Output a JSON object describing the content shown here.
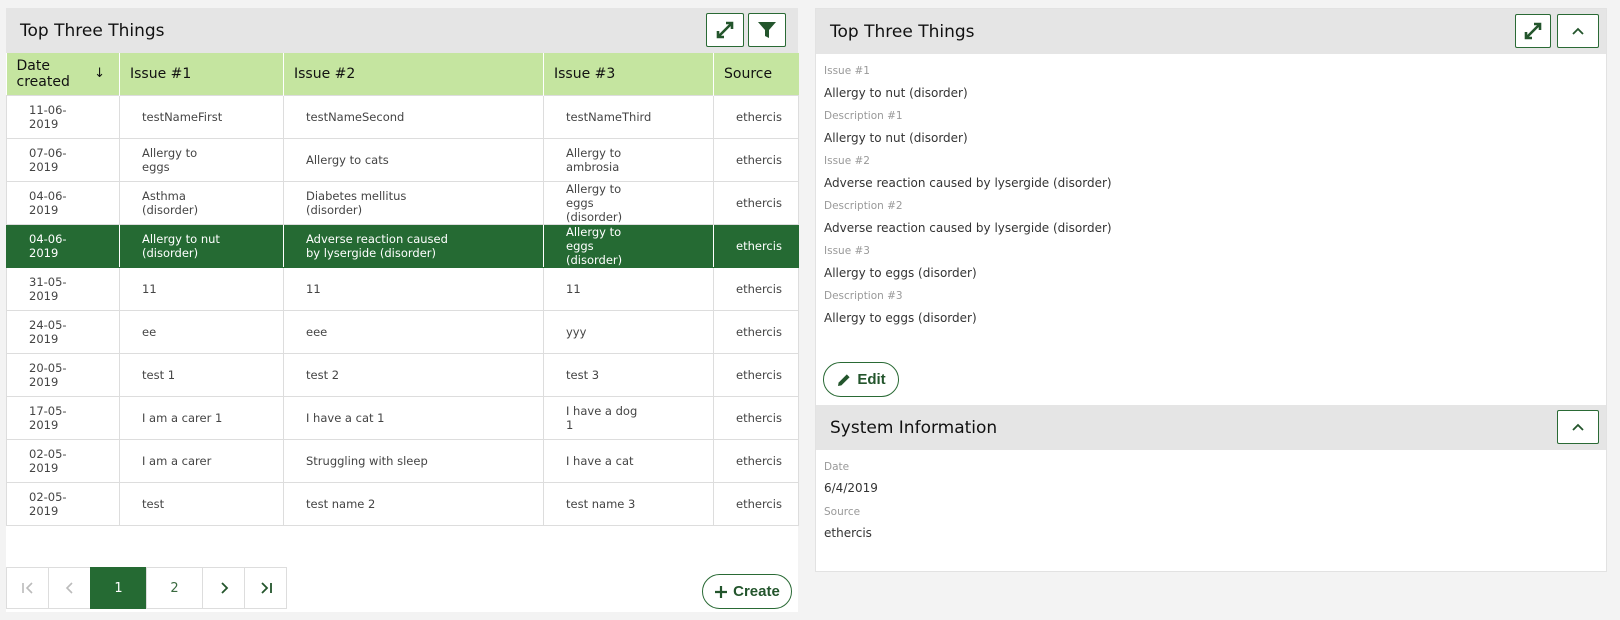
{
  "left": {
    "title": "Top Three Things",
    "columns": {
      "date": "Date created",
      "issue1": "Issue #1",
      "issue2": "Issue #2",
      "issue3": "Issue #3",
      "source": "Source"
    },
    "rows": [
      {
        "date": "11-06-2019",
        "issue1": "testNameFirst",
        "issue2": "testNameSecond",
        "issue3": "testNameThird",
        "source": "ethercis"
      },
      {
        "date": "07-06-2019",
        "issue1": "Allergy to eggs",
        "issue2": "Allergy to cats",
        "issue3": "Allergy to ambrosia",
        "source": "ethercis"
      },
      {
        "date": "04-06-2019",
        "issue1": "Asthma (disorder)",
        "issue2": "Diabetes mellitus (disorder)",
        "issue3": "Allergy to eggs (disorder)",
        "source": "ethercis"
      },
      {
        "date": "04-06-2019",
        "issue1": "Allergy to nut (disorder)",
        "issue2": "Adverse reaction caused by lysergide (disorder)",
        "issue3": "Allergy to eggs (disorder)",
        "source": "ethercis"
      },
      {
        "date": "31-05-2019",
        "issue1": "11",
        "issue2": "11",
        "issue3": "11",
        "source": "ethercis"
      },
      {
        "date": "24-05-2019",
        "issue1": "ee",
        "issue2": "eee",
        "issue3": "yyy",
        "source": "ethercis"
      },
      {
        "date": "20-05-2019",
        "issue1": "test 1",
        "issue2": "test 2",
        "issue3": "test 3",
        "source": "ethercis"
      },
      {
        "date": "17-05-2019",
        "issue1": "I am a carer 1",
        "issue2": "I have a cat 1",
        "issue3": "I have a dog 1",
        "source": "ethercis"
      },
      {
        "date": "02-05-2019",
        "issue1": "I am a carer",
        "issue2": "Struggling with sleep",
        "issue3": "I have a cat",
        "source": "ethercis"
      },
      {
        "date": "02-05-2019",
        "issue1": "test",
        "issue2": "test name 2",
        "issue3": "test name 3",
        "source": "ethercis"
      }
    ],
    "selected_row": 3,
    "pagination": {
      "pages": [
        "1",
        "2"
      ],
      "current": "1"
    },
    "create_label": "Create"
  },
  "right": {
    "title": "Top Three Things",
    "fields": [
      {
        "label": "Issue #1",
        "value": "Allergy to nut (disorder)"
      },
      {
        "label": "Description #1",
        "value": "Allergy to nut (disorder)"
      },
      {
        "label": "Issue #2",
        "value": "Adverse reaction caused by lysergide (disorder)"
      },
      {
        "label": "Description #2",
        "value": "Adverse reaction caused by lysergide (disorder)"
      },
      {
        "label": "Issue #3",
        "value": "Allergy to eggs (disorder)"
      },
      {
        "label": "Description #3",
        "value": "Allergy to eggs (disorder)"
      }
    ],
    "edit_label": "Edit",
    "system": {
      "title": "System Information",
      "fields": [
        {
          "label": "Date",
          "value": "6/4/2019"
        },
        {
          "label": "Source",
          "value": "ethercis"
        }
      ]
    }
  },
  "colors": {
    "accent": "#256a33",
    "header_green": "#c5e5a0",
    "panel_header": "#e5e5e5"
  }
}
